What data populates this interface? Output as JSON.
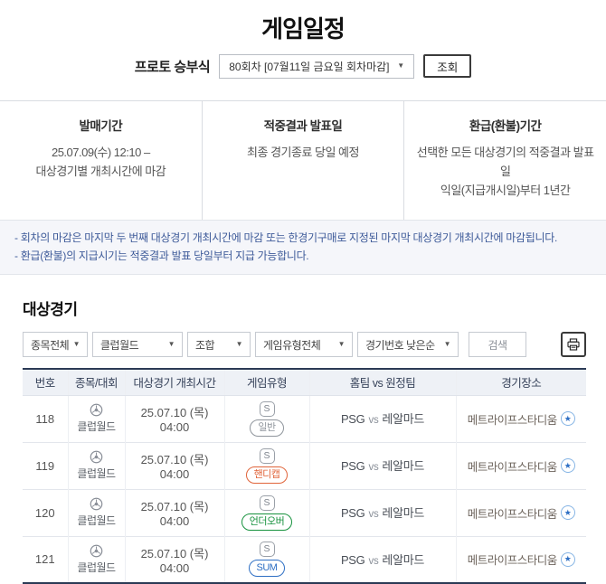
{
  "page": {
    "title": "게임일정"
  },
  "round_selector": {
    "label": "프로토 승부식",
    "selected": "80회차 [07월11일 금요일 회차마감]",
    "inquiry_label": "조회"
  },
  "info_columns": [
    {
      "title": "발매기간",
      "line1": "25.07.09(수) 12:10 –",
      "line2": "대상경기별 개최시간에 마감"
    },
    {
      "title": "적중결과 발표일",
      "line1": "최종 경기종료 당일 예정",
      "line2": ""
    },
    {
      "title": "환급(환불)기간",
      "line1": "선택한 모든 대상경기의 적중결과 발표일",
      "line2": "익일(지급개시일)부터 1년간"
    }
  ],
  "notes": {
    "line1": "- 회차의 마감은 마지막 두 번째 대상경기 개최시간에 마감 또는 한경기구매로 지정된 마지막 대상경기 개최시간에 마감됩니다.",
    "line2": "- 환급(환불)의 지급시기는 적중결과 발표 당일부터 지급 가능합니다."
  },
  "section": {
    "title": "대상경기"
  },
  "filters": {
    "selects": [
      "종목전체",
      "클럽월드",
      "조합",
      "게임유형전체",
      "경기번호 낮은순"
    ],
    "search_label": "검색",
    "print_icon": "printer-icon"
  },
  "table": {
    "headers": [
      "번호",
      "종목/대회",
      "대상경기 개최시간",
      "게임유형",
      "홈팀 vs 원정팀",
      "경기장소"
    ],
    "rows": [
      {
        "no": "118",
        "league": "클럽월드",
        "time": "25.07.10 (목) 04:00",
        "s_mark": "S",
        "type_label": "일반",
        "type_color": "#8f959c",
        "home": "PSG",
        "vs": "vs",
        "away": "레알마드",
        "venue": "메트라이프스타디움"
      },
      {
        "no": "119",
        "league": "클럽월드",
        "time": "25.07.10 (목) 04:00",
        "s_mark": "S",
        "type_label": "핸디캡",
        "type_color": "#e0643a",
        "home": "PSG",
        "vs": "vs",
        "away": "레알마드",
        "venue": "메트라이프스타디움"
      },
      {
        "no": "120",
        "league": "클럽월드",
        "time": "25.07.10 (목) 04:00",
        "s_mark": "S",
        "type_label": "언더오버",
        "type_color": "#17923e",
        "home": "PSG",
        "vs": "vs",
        "away": "레알마드",
        "venue": "메트라이프스타디움"
      },
      {
        "no": "121",
        "league": "클럽월드",
        "time": "25.07.10 (목) 04:00",
        "s_mark": "S",
        "type_label": "SUM",
        "type_color": "#2e6fc4",
        "home": "PSG",
        "vs": "vs",
        "away": "레알마드",
        "venue": "메트라이프스타디움"
      }
    ]
  },
  "colors": {
    "accent_navy": "#2b3a55",
    "note_blue": "#3d5a99",
    "star_blue": "#2e6fc4"
  }
}
